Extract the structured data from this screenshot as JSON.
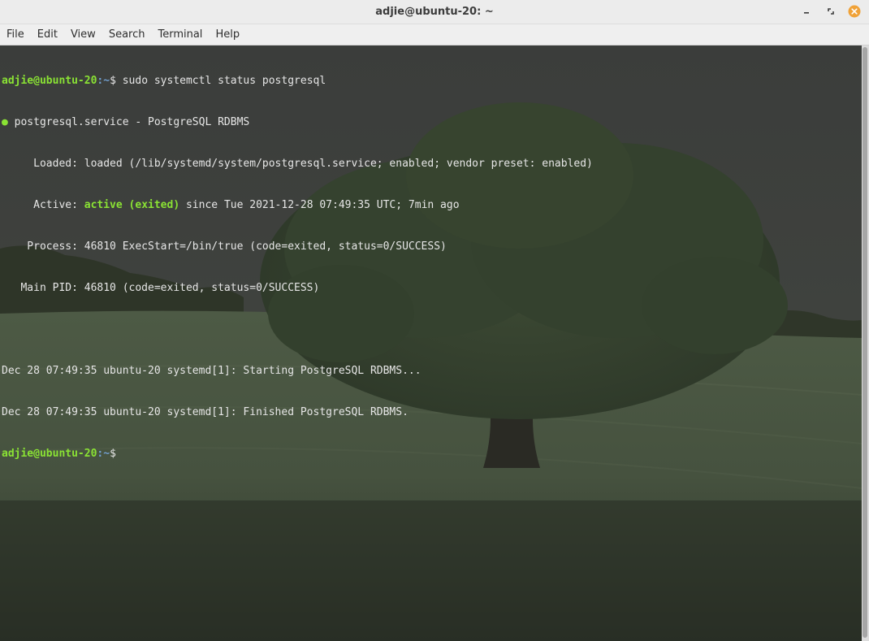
{
  "window": {
    "title": "adjie@ubuntu-20: ~",
    "controls": {
      "minimize_icon": "minimize-icon",
      "maximize_icon": "maximize-icon",
      "close_icon": "close-icon",
      "close_color": "#f0a238"
    }
  },
  "menu": {
    "items": [
      "File",
      "Edit",
      "View",
      "Search",
      "Terminal",
      "Help"
    ]
  },
  "terminal": {
    "colors": {
      "prompt_user": "#8ae234",
      "prompt_path": "#729fcf",
      "text": "#e6e6e6",
      "active": "#8ae234"
    },
    "prompt": {
      "user_host": "adjie@ubuntu-20",
      "path": ":~",
      "symbol": "$"
    },
    "command": " sudo systemctl status postgresql",
    "status": {
      "dot": "●",
      "service_line": " postgresql.service - PostgreSQL RDBMS",
      "loaded_line": "     Loaded: loaded (/lib/systemd/system/postgresql.service; enabled; vendor preset: enabled)",
      "active_label": "     Active: ",
      "active_state": "active (exited)",
      "active_rest": " since Tue 2021-12-28 07:49:35 UTC; 7min ago",
      "process_line": "    Process: 46810 ExecStart=/bin/true (code=exited, status=0/SUCCESS)",
      "main_pid_line": "   Main PID: 46810 (code=exited, status=0/SUCCESS)"
    },
    "log": [
      "Dec 28 07:49:35 ubuntu-20 systemd[1]: Starting PostgreSQL RDBMS...",
      "Dec 28 07:49:35 ubuntu-20 systemd[1]: Finished PostgreSQL RDBMS."
    ],
    "final_prompt": {
      "user_host": "adjie@ubuntu-20",
      "path": ":~",
      "symbol": "$"
    }
  }
}
